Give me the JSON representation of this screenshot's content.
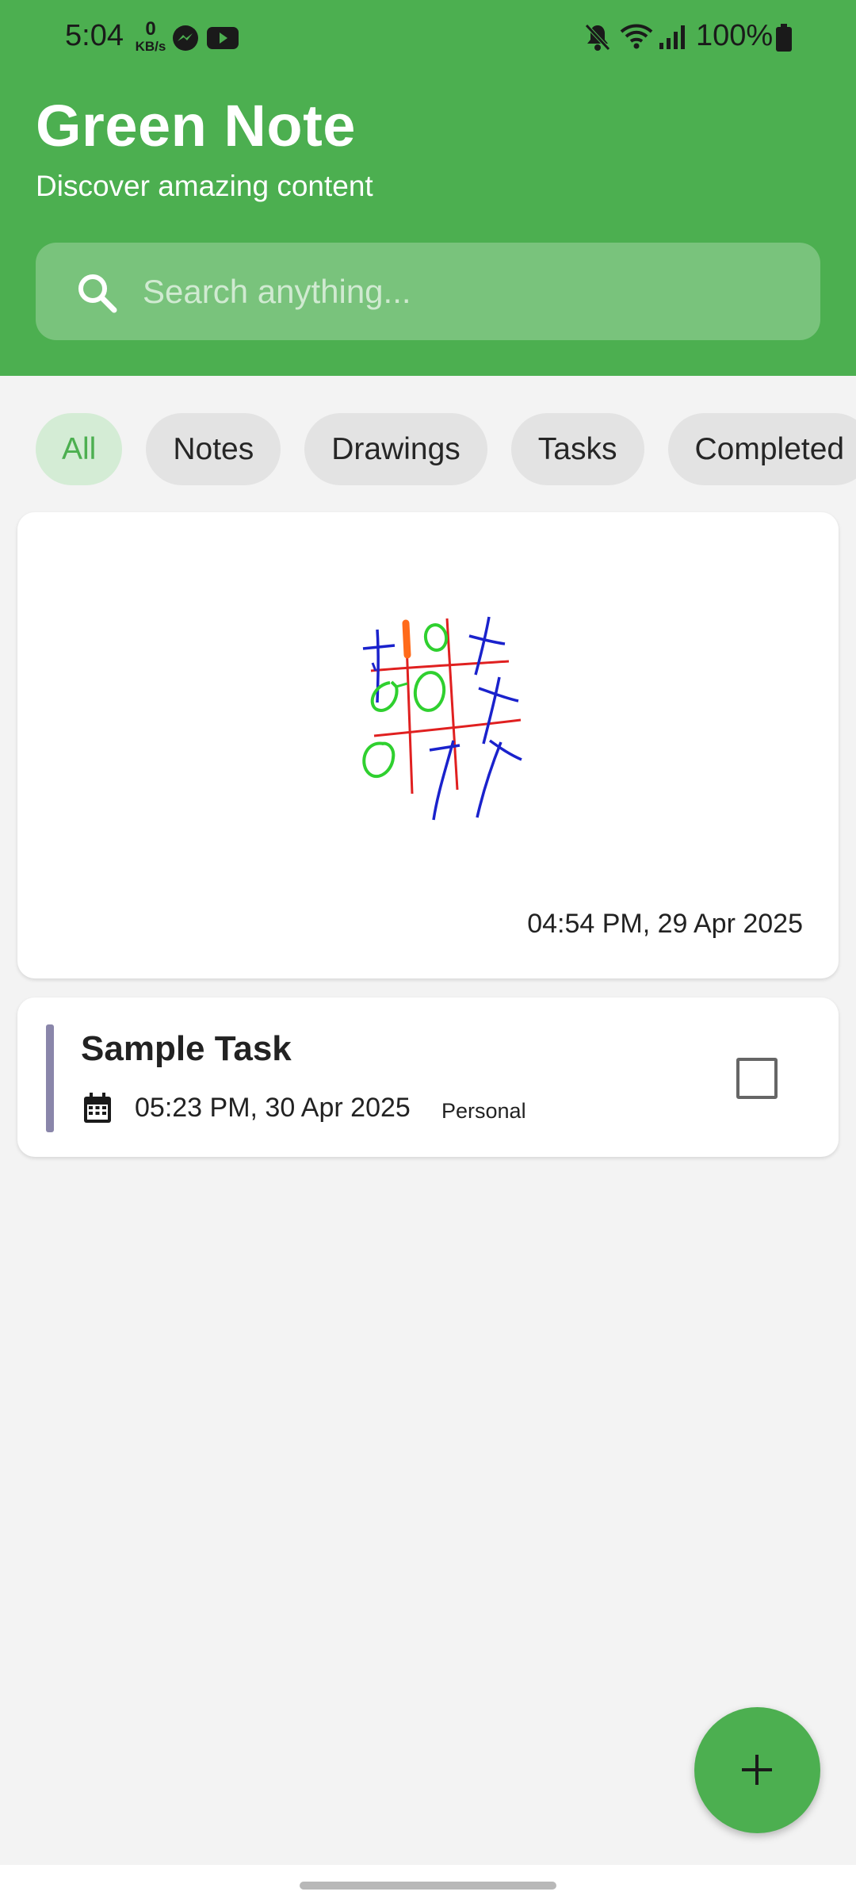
{
  "status_bar": {
    "time": "5:04",
    "speed_value": "0",
    "speed_unit": "KB/s",
    "battery": "100%",
    "icons": [
      "messenger-icon",
      "youtube-icon",
      "mute-icon",
      "wifi-icon",
      "signal-icon",
      "battery-icon"
    ]
  },
  "header": {
    "title": "Green Note",
    "subtitle": "Discover amazing content",
    "background_color": "#4caf50"
  },
  "search": {
    "placeholder": "Search anything...",
    "value": ""
  },
  "filters": {
    "items": [
      {
        "label": "All",
        "active": true
      },
      {
        "label": "Notes",
        "active": false
      },
      {
        "label": "Drawings",
        "active": false
      },
      {
        "label": "Tasks",
        "active": false
      },
      {
        "label": "Completed",
        "active": false
      }
    ]
  },
  "items": [
    {
      "type": "drawing",
      "timestamp": "04:54 PM, 29 Apr 2025"
    },
    {
      "type": "task",
      "title": "Sample Task",
      "due": "05:23 PM, 30 Apr 2025",
      "category": "Personal",
      "completed": false,
      "accent_color": "#8a86aa"
    }
  ],
  "fab": {
    "icon": "plus-icon",
    "color": "#4caf50"
  }
}
